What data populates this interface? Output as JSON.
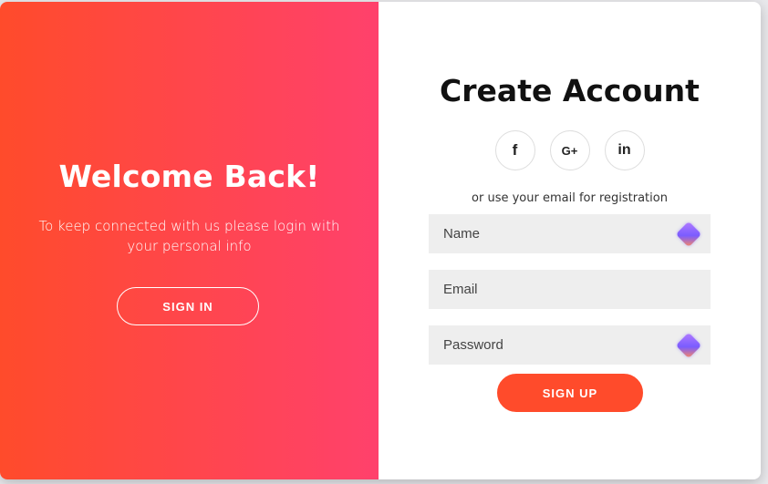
{
  "overlay": {
    "title": "Welcome Back!",
    "text": "To keep connected with us please login with your personal info",
    "signin_label": "SIGN IN",
    "gradient_start": "#ff4b2b",
    "gradient_end": "#ff416c"
  },
  "form": {
    "title": "Create Account",
    "socials": [
      {
        "icon": "facebook-icon",
        "glyph": "f"
      },
      {
        "icon": "google-plus-icon",
        "glyph": "G+"
      },
      {
        "icon": "linkedin-icon",
        "glyph": "in"
      }
    ],
    "hint": "or use your email for registration",
    "fields": {
      "name": {
        "placeholder": "Name",
        "value": ""
      },
      "email": {
        "placeholder": "Email",
        "value": ""
      },
      "password": {
        "placeholder": "Password",
        "value": ""
      }
    },
    "signup_label": "SIGN UP",
    "accent": "#ff4b2b"
  }
}
